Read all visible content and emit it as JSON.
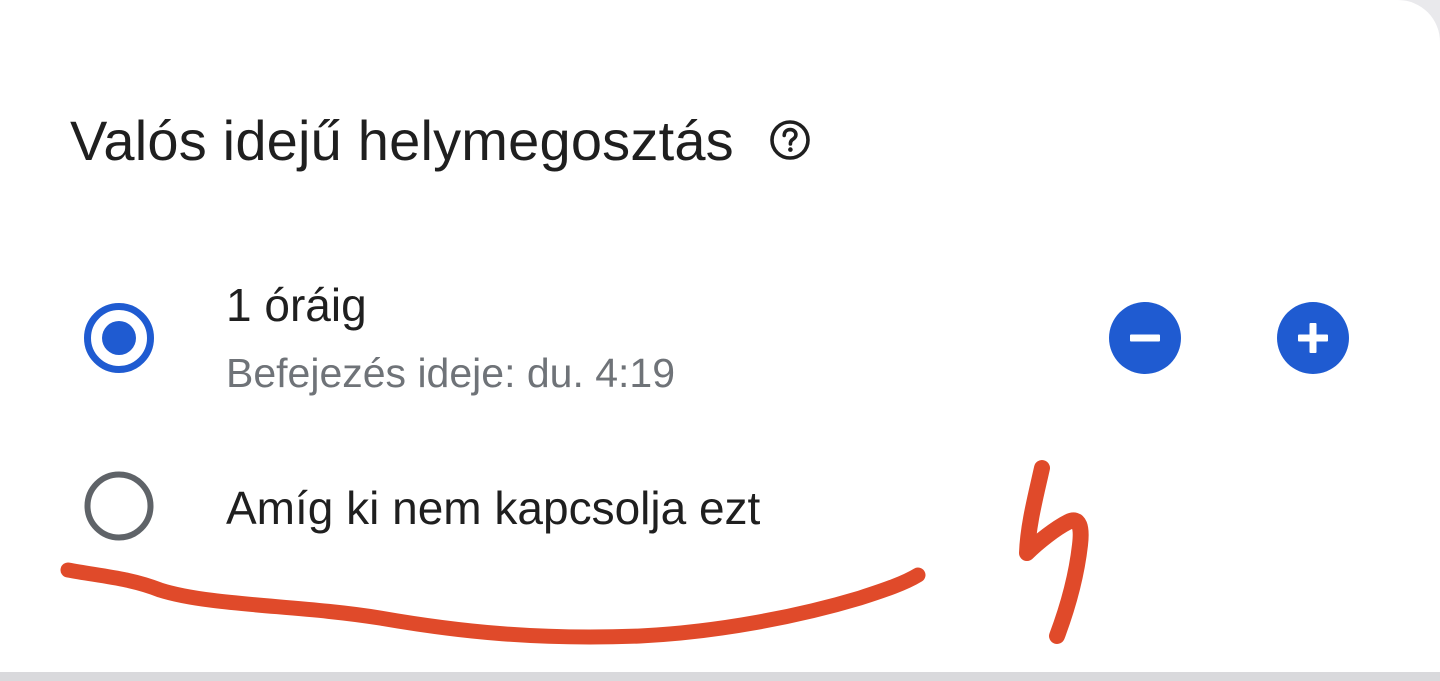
{
  "dialog": {
    "title": "Valós idejű helymegosztás",
    "help_icon": "help-circle-icon"
  },
  "options": [
    {
      "label": "1 óráig",
      "sublabel": "Befejezés ideje: du. 4:19",
      "selected": true,
      "stepper": {
        "decrease_icon": "minus-circle-icon",
        "increase_icon": "plus-circle-icon"
      }
    },
    {
      "label": "Amíg ki nem kapcsolja ezt",
      "selected": false
    }
  ],
  "colors": {
    "accent": "#1f5bd1",
    "text_primary": "#1f1f1f",
    "text_secondary": "#6f7378",
    "radio_unselected": "#5f6368",
    "annotation_red": "#e04a2a"
  }
}
